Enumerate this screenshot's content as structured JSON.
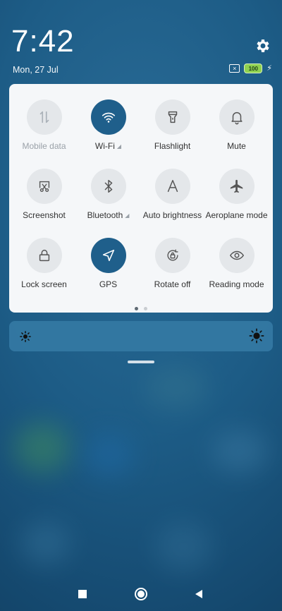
{
  "status": {
    "time": "7:42",
    "date": "Mon, 27 Jul",
    "battery_level": "100"
  },
  "quick_settings": {
    "tiles": [
      {
        "label": "Mobile data",
        "icon": "mobile-data-icon",
        "active": false,
        "disabled": true
      },
      {
        "label": "Wi-Fi",
        "icon": "wifi-icon",
        "active": true,
        "disabled": false,
        "has_arrow": true
      },
      {
        "label": "Flashlight",
        "icon": "flashlight-icon",
        "active": false,
        "disabled": false
      },
      {
        "label": "Mute",
        "icon": "bell-icon",
        "active": false,
        "disabled": false
      },
      {
        "label": "Screenshot",
        "icon": "screenshot-icon",
        "active": false,
        "disabled": false
      },
      {
        "label": "Bluetooth",
        "icon": "bluetooth-icon",
        "active": false,
        "disabled": false,
        "has_arrow": true
      },
      {
        "label": "Auto brightness",
        "icon": "auto-brightness-icon",
        "active": false,
        "disabled": false
      },
      {
        "label": "Aeroplane mode",
        "icon": "airplane-icon",
        "active": false,
        "disabled": false
      },
      {
        "label": "Lock screen",
        "icon": "lock-icon",
        "active": false,
        "disabled": false
      },
      {
        "label": "GPS",
        "icon": "location-icon",
        "active": true,
        "disabled": false
      },
      {
        "label": "Rotate off",
        "icon": "rotate-lock-icon",
        "active": false,
        "disabled": false
      },
      {
        "label": "Reading mode",
        "icon": "eye-icon",
        "active": false,
        "disabled": false
      }
    ],
    "page_count": 2,
    "current_page": 1
  },
  "colors": {
    "tile_active": "#1f5f8b",
    "tile_inactive": "#e4e7ea",
    "panel_bg": "#f5f7f9",
    "battery": "#8fd14f"
  }
}
